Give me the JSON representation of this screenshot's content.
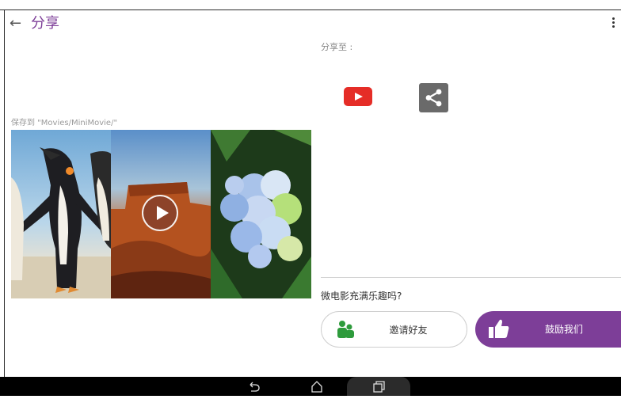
{
  "appbar": {
    "back_icon": "arrow-left-icon",
    "title": "分享",
    "menu_icon": "more-vert-icon"
  },
  "save": {
    "path_label": "保存到 \"Movies/MiniMovie/\""
  },
  "preview": {
    "tiles": [
      {
        "subject": "penguins"
      },
      {
        "subject": "desert-butte"
      },
      {
        "subject": "hydrangea"
      }
    ],
    "play_icon": "play-icon"
  },
  "share": {
    "label": "分享至 :",
    "targets": [
      {
        "icon": "youtube-icon",
        "color": "#e52d27"
      },
      {
        "icon": "share-icon",
        "color": "#6a6a6a"
      }
    ]
  },
  "feedback": {
    "prompt": "微电影充满乐趣吗?",
    "invite_label": "邀请好友",
    "invite_icon": "friends-icon",
    "invite_icon_color": "#2e9b3c",
    "like_label": "鼓励我们",
    "like_icon": "thumbs-up-icon"
  },
  "colors": {
    "accent": "#7d3e98",
    "navbar": "#000000"
  },
  "navbar": {
    "icons": [
      "back-icon",
      "home-icon",
      "recent-apps-icon"
    ]
  }
}
